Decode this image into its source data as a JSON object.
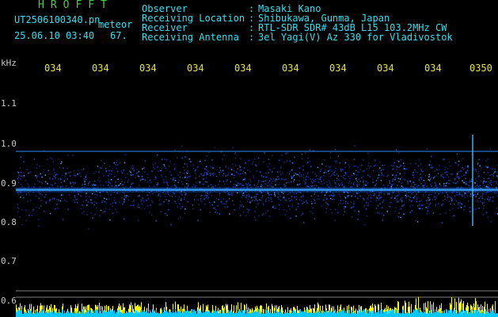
{
  "header": {
    "app_title": "HROFFT",
    "file_name": "UT2506100340.pn",
    "mode": "meteor",
    "datetime": "25.06.10 03:40",
    "counter": "67."
  },
  "meta": [
    {
      "label": "Observer",
      "value": "Masaki Kano"
    },
    {
      "label": "Receiving Location",
      "value": "Shibukawa, Gunma, Japan"
    },
    {
      "label": "Receiver",
      "value": "RTL-SDR SDR# 43dB L15 103.2MHz CW"
    },
    {
      "label": "Receiving Antenna",
      "value": "3el Yagi(V) Az 330 for Vladivostok"
    }
  ],
  "y_axis": {
    "unit": "kHz",
    "ticks": [
      "1.1",
      "1.0",
      "0.9",
      "0.8",
      "0.7",
      "0.6"
    ]
  },
  "x_axis": {
    "ticks": [
      "034",
      "034",
      "034",
      "034",
      "034",
      "034",
      "034",
      "034",
      "034",
      "0350"
    ]
  },
  "colors": {
    "background": "#000000",
    "header_text": "#32e0f0",
    "title_text": "#3fd23f",
    "time_ticks": "#e6e23a",
    "band_signal": "#1e5ad2",
    "carrier_line": "#40c0ff",
    "baseline_fill": "#00c8ff",
    "baseline_spikes": "#ffff00"
  }
}
